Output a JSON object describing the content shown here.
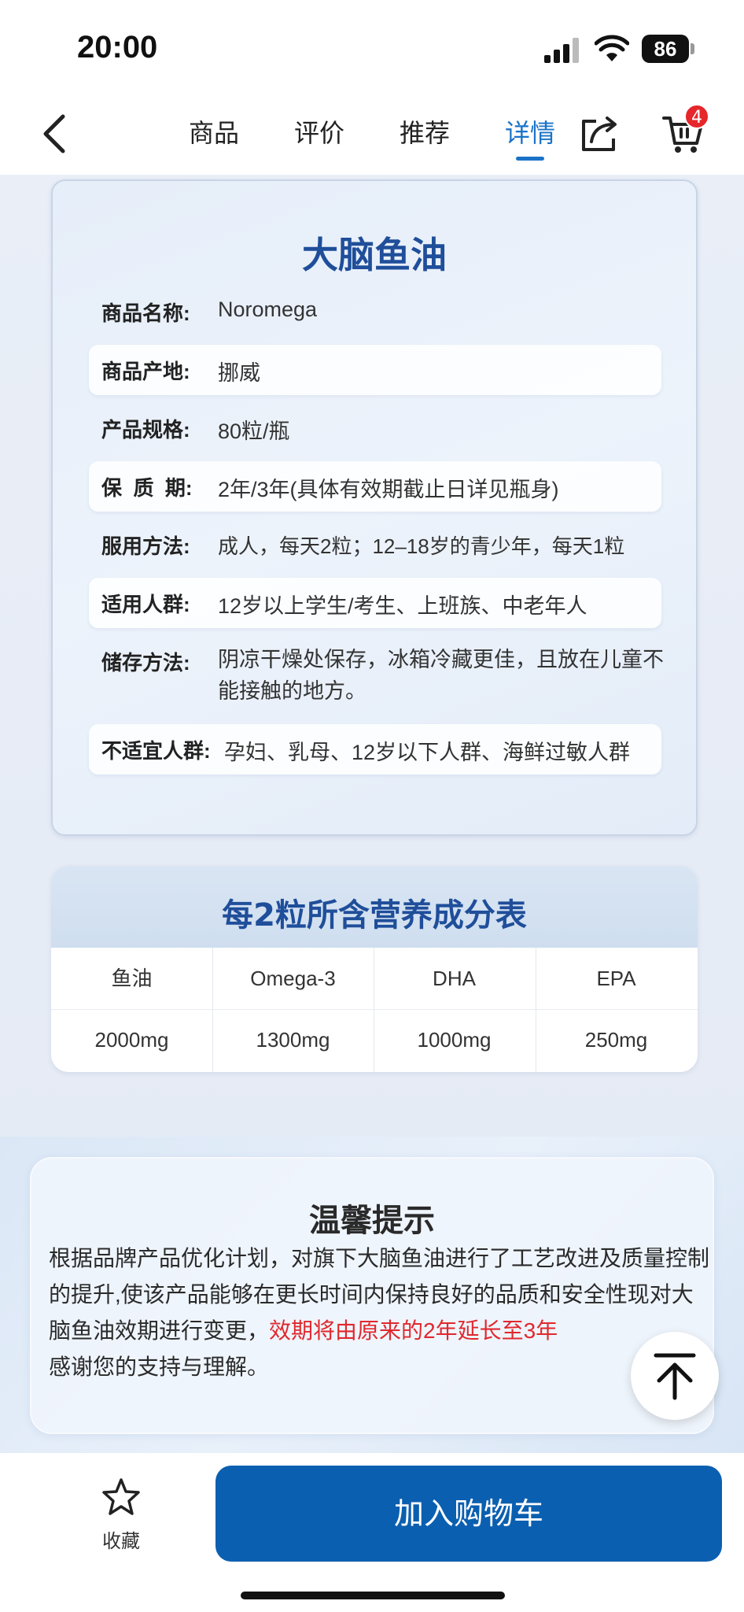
{
  "status_bar": {
    "time": "20:00",
    "battery": "86"
  },
  "nav": {
    "tabs": [
      "商品",
      "评价",
      "推荐",
      "详情"
    ],
    "active_tab": "详情",
    "cart_count": "4"
  },
  "product_card": {
    "title": "大脑鱼油",
    "rows": [
      {
        "label": "商品名称:",
        "value": "Noromega"
      },
      {
        "label": "商品产地:",
        "value": "挪威"
      },
      {
        "label": "产品规格:",
        "value": "80粒/瓶"
      },
      {
        "label": "保  质  期:",
        "value": "2年/3年(具体有效期截止日详见瓶身)"
      },
      {
        "label": "服用方法:",
        "value": "成人，每天2粒；12–18岁的青少年，每天1粒"
      },
      {
        "label": "适用人群:",
        "value": "12岁以上学生/考生、上班族、中老年人"
      },
      {
        "label": "储存方法:",
        "value": "阴凉干燥处保存，冰箱冷藏更佳，且放在儿童不能接触的地方。"
      },
      {
        "label": "不适宜人群:",
        "value": "孕妇、乳母、12岁以下人群、海鲜过敏人群"
      }
    ]
  },
  "nutrition": {
    "title": "每2粒所含营养成分表",
    "headers": [
      "鱼油",
      "Omega-3",
      "DHA",
      "EPA"
    ],
    "values": [
      "2000mg",
      "1300mg",
      "1000mg",
      "250mg"
    ]
  },
  "tip": {
    "title": "温馨提示",
    "text_normal": "根据品牌产品优化计划，对旗下大脑鱼油进行了工艺改进及质量控制的提升,使该产品能够在更长时间内保持良好的品质和安全性现对大脑鱼油效期进行变更，",
    "text_highlight": "效期将由原来的2年延长至3年",
    "text_end": "感谢您的支持与理解。"
  },
  "bottom_bar": {
    "favorite_label": "收藏",
    "add_to_cart_label": "加入购物车"
  },
  "colors": {
    "accent": "#1a73c8",
    "title_blue": "#1f4e9a",
    "button_blue": "#0b5fb0",
    "badge_red": "#e5262a",
    "highlight_red": "#e0282e"
  }
}
